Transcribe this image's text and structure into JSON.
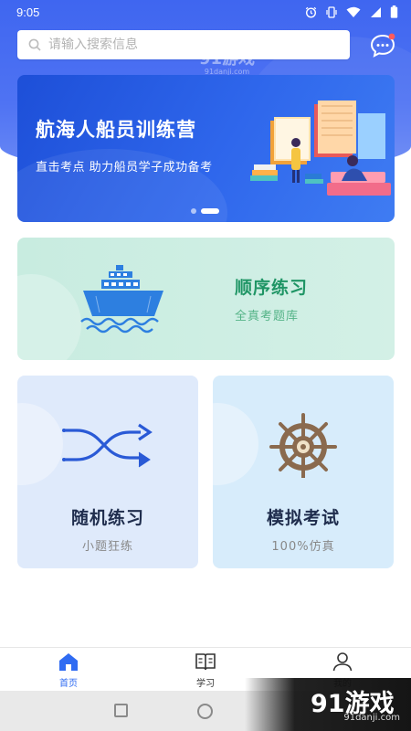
{
  "status_bar": {
    "time": "9:05"
  },
  "search": {
    "placeholder": "请输入搜索信息"
  },
  "watermark": {
    "brand": "91游戏",
    "site": "91danji.com"
  },
  "banner": {
    "title": "航海人船员训练营",
    "subtitle": "直击考点  助力船员学子成功备考",
    "slides": 2,
    "active_slide": 2
  },
  "cards": {
    "sequential": {
      "title": "顺序练习",
      "subtitle": "全真考题库"
    },
    "random": {
      "title": "随机练习",
      "subtitle": "小题狂练"
    },
    "mock": {
      "title": "模拟考试",
      "subtitle": "100%仿真"
    }
  },
  "bottom_nav": {
    "items": [
      {
        "label": "首页",
        "icon": "home-icon",
        "active": true
      },
      {
        "label": "学习",
        "icon": "book-icon",
        "active": false
      },
      {
        "label": "我的",
        "icon": "user-icon",
        "active": false
      }
    ]
  },
  "colors": {
    "header_blue": "#3f66f0",
    "accent_blue": "#2f6bf2",
    "green_title": "#1f9565",
    "navy_title": "#1f2d4d"
  }
}
